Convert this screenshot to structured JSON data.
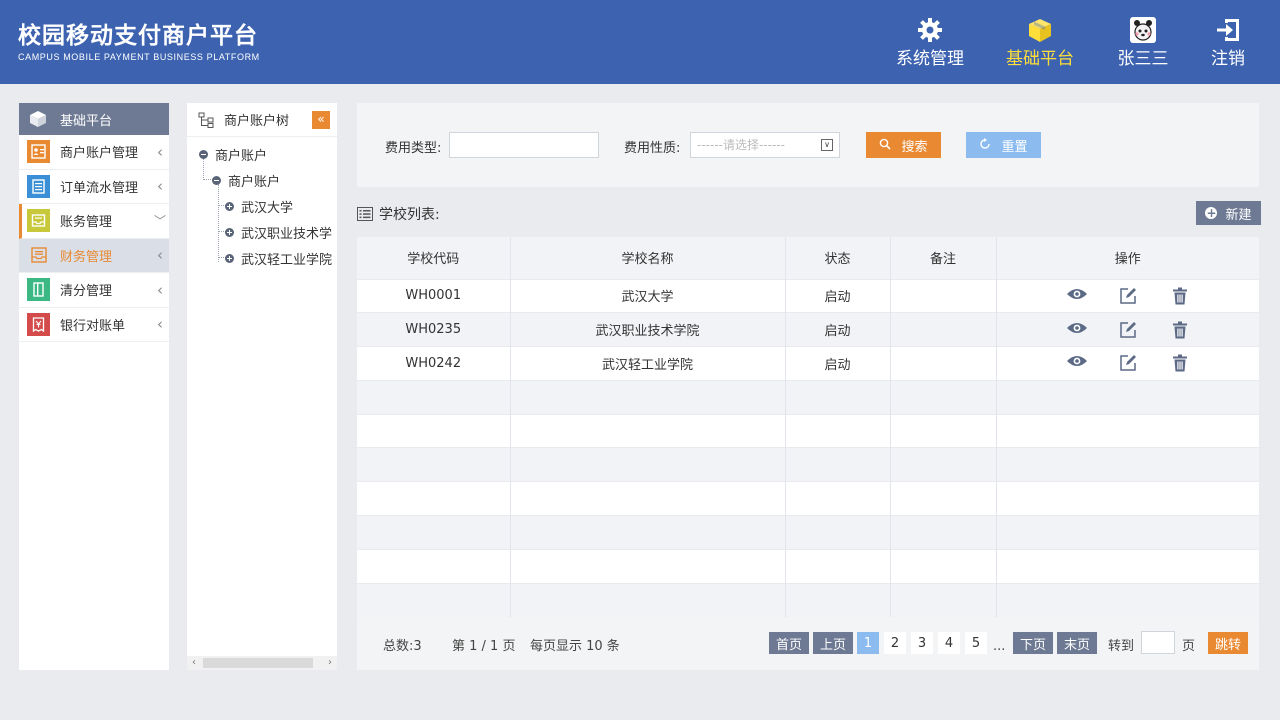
{
  "header": {
    "title": "校园移动支付商户平台",
    "subtitle": "CAMPUS MOBILE PAYMENT BUSINESS PLATFORM",
    "nav": [
      {
        "label": "系统管理",
        "icon": "gear-icon"
      },
      {
        "label": "基础平台",
        "icon": "cube-icon"
      },
      {
        "label": "张三三",
        "icon": "avatar-icon"
      },
      {
        "label": "注销",
        "icon": "logout-icon"
      }
    ],
    "active_nav": "基础平台"
  },
  "sidebar": {
    "title": "基础平台",
    "items": [
      {
        "label": "商户账户管理",
        "icon": "merchant-card-icon",
        "color": "#e98a33"
      },
      {
        "label": "订单流水管理",
        "icon": "document-icon",
        "color": "#3a8fd6"
      },
      {
        "label": "账务管理",
        "icon": "inbox-icon",
        "color": "#c8c83b",
        "expanded": true
      },
      {
        "label": "财务管理",
        "icon": "finance-icon",
        "color": "#e98a33",
        "selected": true
      },
      {
        "label": "清分管理",
        "icon": "book-icon",
        "color": "#3cb884"
      },
      {
        "label": "银行对账单",
        "icon": "receipt-icon",
        "color": "#d34b4b"
      }
    ]
  },
  "tree": {
    "title": "商户账户树",
    "collapse_glyph": "«",
    "root": "商户账户",
    "child": "商户账户",
    "leaves": [
      "武汉大学",
      "武汉职业技术学",
      "武汉轻工业学院"
    ]
  },
  "search": {
    "fee_type_label": "费用类型:",
    "fee_type_value": "",
    "fee_nature_label": "费用性质:",
    "fee_nature_placeholder": "------请选择------",
    "search_button": "搜索",
    "reset_button": "重置"
  },
  "list": {
    "title": "学校列表:",
    "new_button": "新建",
    "columns": [
      "学校代码",
      "学校名称",
      "状态",
      "备注",
      "操作"
    ],
    "rows": [
      {
        "code": "WH0001",
        "name": "武汉大学",
        "status": "启动",
        "note": ""
      },
      {
        "code": "WH0235",
        "name": "武汉职业技术学院",
        "status": "启动",
        "note": ""
      },
      {
        "code": "WH0242",
        "name": "武汉轻工业学院",
        "status": "启动",
        "note": ""
      }
    ],
    "empty_rows": 7
  },
  "pager": {
    "total": "总数:3",
    "page_info": "第 1 / 1 页",
    "per_page": "每页显示 10 条",
    "first": "首页",
    "prev": "上页",
    "pages": [
      "1",
      "2",
      "3",
      "4",
      "5"
    ],
    "current_page": "1",
    "ellipsis": "...",
    "next": "下页",
    "last": "末页",
    "goto_label": "转到",
    "page_unit": "页",
    "jump": "跳转"
  }
}
